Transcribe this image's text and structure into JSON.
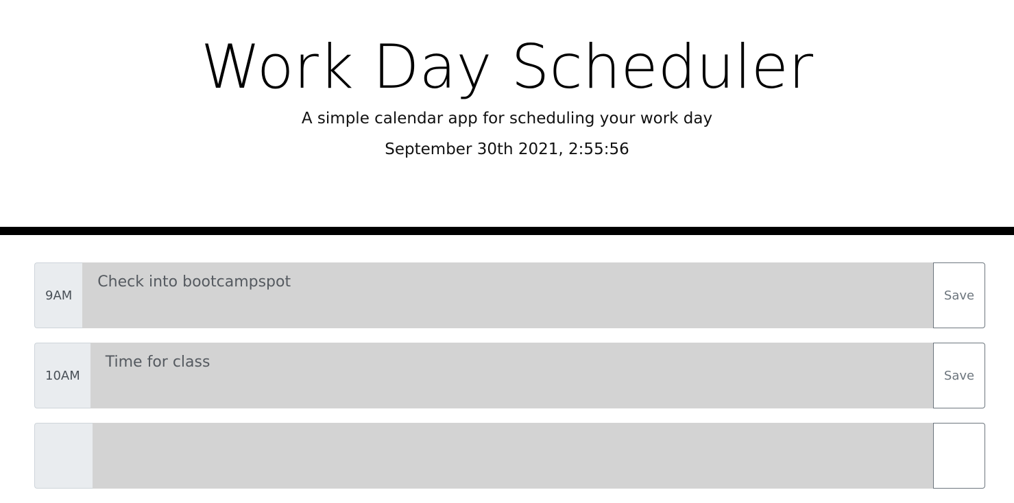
{
  "header": {
    "title": "Work Day Scheduler",
    "subtitle": "A simple calendar app for scheduling your work day",
    "current_day": "September 30th 2021, 2:55:56"
  },
  "colors": {
    "past": "#d3d3d3",
    "divider": "#000000",
    "hour_bg": "#e9ecef"
  },
  "time_blocks": [
    {
      "hour": "9AM",
      "description": "Check into bootcampspot",
      "save_label": "Save"
    },
    {
      "hour": "10AM",
      "description": "Time for class",
      "save_label": "Save"
    },
    {
      "hour": "",
      "description": "",
      "save_label": ""
    }
  ]
}
